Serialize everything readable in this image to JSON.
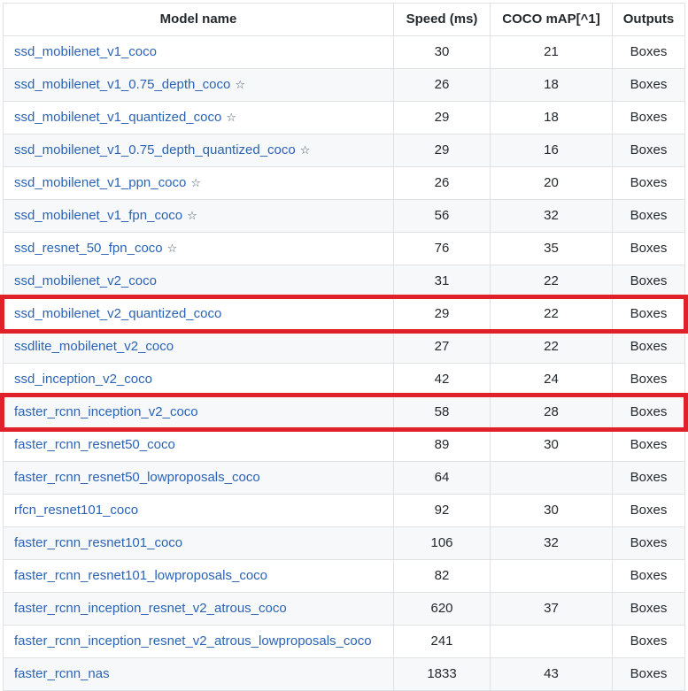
{
  "table": {
    "headers": {
      "name": "Model name",
      "speed": "Speed (ms)",
      "map": "COCO mAP[^1]",
      "outputs": "Outputs"
    },
    "rows": [
      {
        "name": "ssd_mobilenet_v1_coco",
        "star": "",
        "speed": "30",
        "map": "21",
        "outputs": "Boxes"
      },
      {
        "name": "ssd_mobilenet_v1_0.75_depth_coco",
        "star": "☆",
        "speed": "26",
        "map": "18",
        "outputs": "Boxes"
      },
      {
        "name": "ssd_mobilenet_v1_quantized_coco",
        "star": "☆",
        "speed": "29",
        "map": "18",
        "outputs": "Boxes"
      },
      {
        "name": "ssd_mobilenet_v1_0.75_depth_quantized_coco",
        "star": "☆",
        "speed": "29",
        "map": "16",
        "outputs": "Boxes"
      },
      {
        "name": "ssd_mobilenet_v1_ppn_coco",
        "star": "☆",
        "speed": "26",
        "map": "20",
        "outputs": "Boxes"
      },
      {
        "name": "ssd_mobilenet_v1_fpn_coco",
        "star": "☆",
        "speed": "56",
        "map": "32",
        "outputs": "Boxes"
      },
      {
        "name": "ssd_resnet_50_fpn_coco",
        "star": "☆",
        "speed": "76",
        "map": "35",
        "outputs": "Boxes"
      },
      {
        "name": "ssd_mobilenet_v2_coco",
        "star": "",
        "speed": "31",
        "map": "22",
        "outputs": "Boxes"
      },
      {
        "name": "ssd_mobilenet_v2_quantized_coco",
        "star": "",
        "speed": "29",
        "map": "22",
        "outputs": "Boxes"
      },
      {
        "name": "ssdlite_mobilenet_v2_coco",
        "star": "",
        "speed": "27",
        "map": "22",
        "outputs": "Boxes"
      },
      {
        "name": "ssd_inception_v2_coco",
        "star": "",
        "speed": "42",
        "map": "24",
        "outputs": "Boxes"
      },
      {
        "name": "faster_rcnn_inception_v2_coco",
        "star": "",
        "speed": "58",
        "map": "28",
        "outputs": "Boxes"
      },
      {
        "name": "faster_rcnn_resnet50_coco",
        "star": "",
        "speed": "89",
        "map": "30",
        "outputs": "Boxes"
      },
      {
        "name": "faster_rcnn_resnet50_lowproposals_coco",
        "star": "",
        "speed": "64",
        "map": "",
        "outputs": "Boxes"
      },
      {
        "name": "rfcn_resnet101_coco",
        "star": "",
        "speed": "92",
        "map": "30",
        "outputs": "Boxes"
      },
      {
        "name": "faster_rcnn_resnet101_coco",
        "star": "",
        "speed": "106",
        "map": "32",
        "outputs": "Boxes"
      },
      {
        "name": "faster_rcnn_resnet101_lowproposals_coco",
        "star": "",
        "speed": "82",
        "map": "",
        "outputs": "Boxes"
      },
      {
        "name": "faster_rcnn_inception_resnet_v2_atrous_coco",
        "star": "",
        "speed": "620",
        "map": "37",
        "outputs": "Boxes"
      },
      {
        "name": "faster_rcnn_inception_resnet_v2_atrous_lowproposals_coco",
        "star": "",
        "speed": "241",
        "map": "",
        "outputs": "Boxes"
      },
      {
        "name": "faster_rcnn_nas",
        "star": "",
        "speed": "1833",
        "map": "43",
        "outputs": "Boxes"
      }
    ]
  },
  "highlights": {
    "color": "#e0202a",
    "rows": [
      "ssd_mobilenet_v2_quantized_coco",
      "faster_rcnn_inception_v2_coco"
    ]
  },
  "colors": {
    "link": "#2b63b5",
    "border": "#dfe2e5",
    "stripe": "#f6f8fa"
  }
}
